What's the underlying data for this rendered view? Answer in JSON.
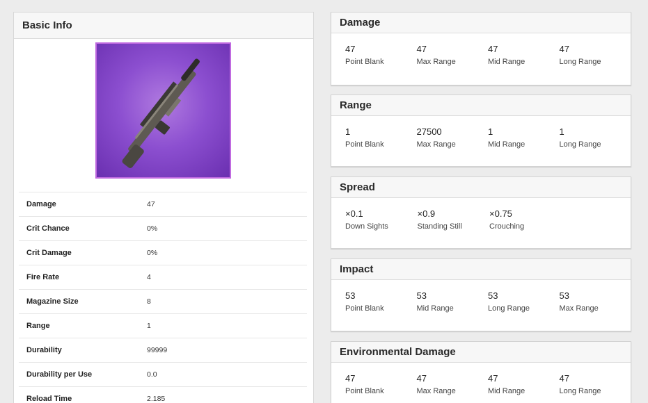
{
  "basic_info": {
    "title": "Basic Info",
    "stats": [
      {
        "label": "Damage",
        "value": "47"
      },
      {
        "label": "Crit Chance",
        "value": "0%"
      },
      {
        "label": "Crit Damage",
        "value": "0%"
      },
      {
        "label": "Fire Rate",
        "value": "4"
      },
      {
        "label": "Magazine Size",
        "value": "8"
      },
      {
        "label": "Range",
        "value": "1"
      },
      {
        "label": "Durability",
        "value": "99999"
      },
      {
        "label": "Durability per Use",
        "value": "0.0"
      },
      {
        "label": "Reload Time",
        "value": "2.185"
      }
    ],
    "frame_color": "#c06ae0"
  },
  "damage": {
    "title": "Damage",
    "cells": [
      {
        "value": "47",
        "label": "Point Blank"
      },
      {
        "value": "47",
        "label": "Max Range"
      },
      {
        "value": "47",
        "label": "Mid Range"
      },
      {
        "value": "47",
        "label": "Long Range"
      }
    ]
  },
  "range": {
    "title": "Range",
    "cells": [
      {
        "value": "1",
        "label": "Point Blank"
      },
      {
        "value": "27500",
        "label": "Max Range"
      },
      {
        "value": "1",
        "label": "Mid Range"
      },
      {
        "value": "1",
        "label": "Long Range"
      }
    ]
  },
  "spread": {
    "title": "Spread",
    "cells": [
      {
        "value": "×0.1",
        "label": "Down Sights"
      },
      {
        "value": "×0.9",
        "label": "Standing Still"
      },
      {
        "value": "×0.75",
        "label": "Crouching"
      }
    ]
  },
  "impact": {
    "title": "Impact",
    "cells": [
      {
        "value": "53",
        "label": "Point Blank"
      },
      {
        "value": "53",
        "label": "Mid Range"
      },
      {
        "value": "53",
        "label": "Long Range"
      },
      {
        "value": "53",
        "label": "Max Range"
      }
    ]
  },
  "environmental_damage": {
    "title": "Environmental Damage",
    "cells": [
      {
        "value": "47",
        "label": "Point Blank"
      },
      {
        "value": "47",
        "label": "Max Range"
      },
      {
        "value": "47",
        "label": "Mid Range"
      },
      {
        "value": "47",
        "label": "Long Range"
      }
    ]
  }
}
